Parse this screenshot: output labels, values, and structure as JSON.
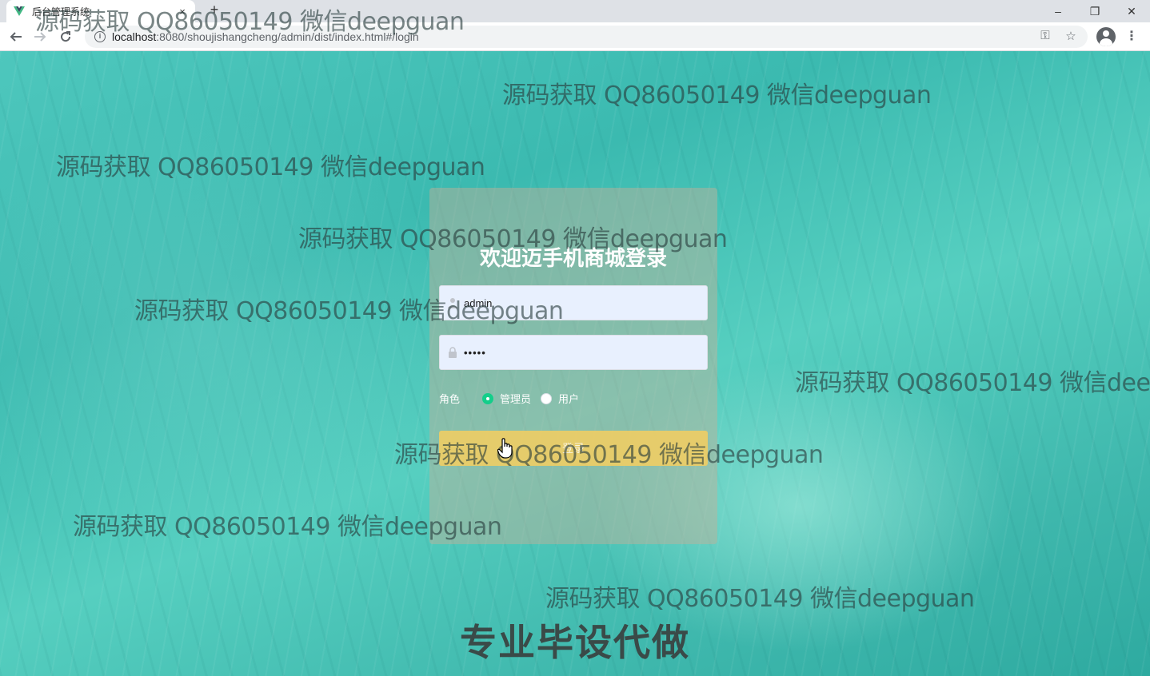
{
  "browser": {
    "tab_title": "后台管理系统",
    "tab_close": "×",
    "new_tab": "+",
    "url_host": "localhost",
    "url_path": ":8080/shoujishangcheng/admin/dist/index.html#/login",
    "window_controls": {
      "minimize": "–",
      "restore": "❐",
      "close": "✕"
    }
  },
  "login": {
    "title": "欢迎迈手机商城登录",
    "username_value": "admin",
    "password_value": "•••••",
    "role_label": "角色",
    "roles": [
      {
        "label": "管理员",
        "checked": true
      },
      {
        "label": "用户",
        "checked": false
      }
    ],
    "login_button": "登录"
  },
  "overlay": {
    "watermark_text": "源码获取 QQ86050149 微信deepguan",
    "promo_text": "专业毕设代做"
  },
  "colors": {
    "radio_checked": "#13ce8a",
    "login_button": "#f0cd64"
  }
}
